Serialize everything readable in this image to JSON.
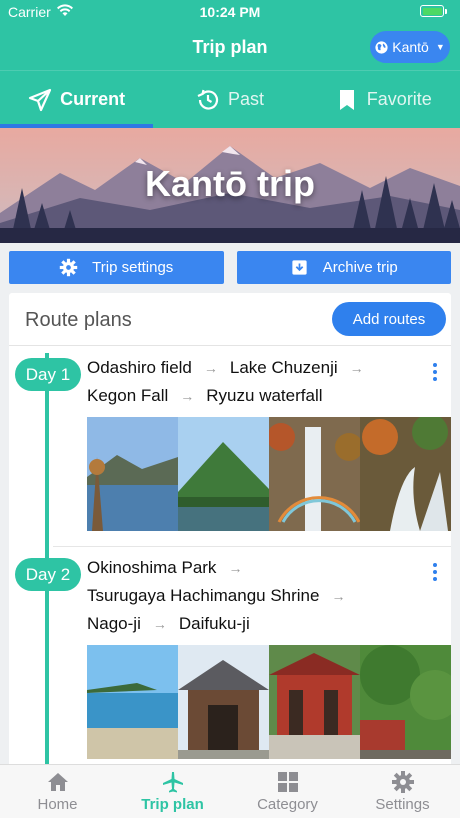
{
  "status": {
    "carrier": "Carrier",
    "time": "10:24 PM"
  },
  "nav": {
    "title": "Trip plan",
    "region": "Kantō"
  },
  "tabs": [
    {
      "label": "Current",
      "icon": "send-icon",
      "active": true
    },
    {
      "label": "Past",
      "icon": "history-icon",
      "active": false
    },
    {
      "label": "Favorite",
      "icon": "bookmark-icon",
      "active": false
    }
  ],
  "banner": {
    "title": "Kantō trip"
  },
  "actions": {
    "settings": "Trip settings",
    "archive": "Archive trip"
  },
  "route": {
    "title": "Route plans",
    "add": "Add routes",
    "days": [
      {
        "badge": "Day 1",
        "places": [
          "Odashiro field",
          "Lake Chuzenji",
          "Kegon Fall",
          "Ryuzu waterfall"
        ]
      },
      {
        "badge": "Day 2",
        "places": [
          "Okinoshima Park",
          "Tsurugaya Hachimangu Shrine",
          "Nago-ji",
          "Daifuku-ji"
        ]
      }
    ]
  },
  "bottom": [
    {
      "label": "Home",
      "icon": "home-icon"
    },
    {
      "label": "Trip plan",
      "icon": "airplane-icon",
      "active": true
    },
    {
      "label": "Category",
      "icon": "grid-icon"
    },
    {
      "label": "Settings",
      "icon": "gear-icon"
    }
  ],
  "colors": {
    "primary": "#2ec4a4",
    "accent": "#3a86f0",
    "tab_indicator": "#2f78e4"
  }
}
